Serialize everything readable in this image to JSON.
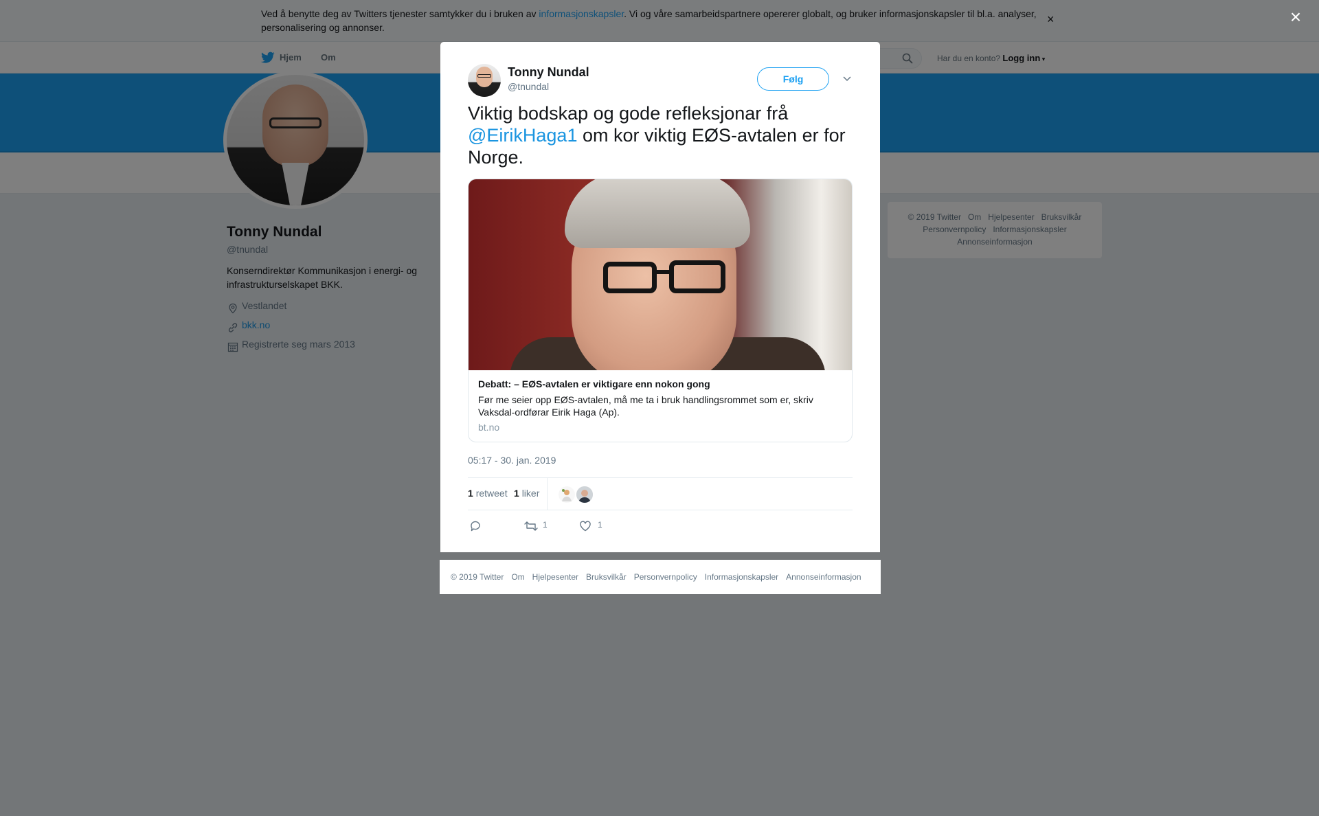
{
  "cookie_banner": {
    "text_before": "Ved å benytte deg av Twitters tjenester samtykker du i bruken av ",
    "link": "informasjonskapsler",
    "text_after": ". Vi og våre samarbeidspartnere opererer globalt, og bruker informasjonskapsler til bl.a. analyser, personalisering og annonser.",
    "close": "×"
  },
  "nav": {
    "home": "Hjem",
    "about": "Om",
    "account_prompt": "Har du en konto?",
    "login": "Logg inn"
  },
  "profile": {
    "name": "Tonny Nundal",
    "handle": "@tnundal",
    "bio": "Konserndirektør Kommunikasjon i energi- og infrastrukturselskapet BKK.",
    "location": "Vestlandet",
    "website": "bkk.no",
    "joined": "Registrerte seg mars 2013"
  },
  "side_footer": {
    "links": [
      "© 2019 Twitter",
      "Om",
      "Hjelpesenter",
      "Bruksvilkår",
      "Personvernpolicy",
      "Informasjonskapsler",
      "Annonseinformasjon"
    ]
  },
  "overlay_close": "×",
  "tweet": {
    "author_name": "Tonny Nundal",
    "author_handle": "@tnundal",
    "follow_label": "Følg",
    "text_part1": "Viktig bodskap og gode refleksjonar frå ",
    "mention": "@EirikHaga1",
    "text_part2": " om kor viktig EØS-avtalen er for Norge.",
    "card": {
      "title": "Debatt: – EØS-avtalen er viktigare enn nokon gong",
      "description": "Før me seier opp EØS-avtalen, må me ta i bruk handlingsrommet som er, skriv Vaksdal-ordførar Eirik Haga (Ap).",
      "domain": "bt.no"
    },
    "timestamp": "05:17 - 30. jan. 2019",
    "retweets_count": "1",
    "retweets_label": "retweet",
    "likes_count": "1",
    "likes_label": "liker",
    "action_retweet_count": "1",
    "action_like_count": "1"
  },
  "modal_footer": {
    "links": [
      "© 2019 Twitter",
      "Om",
      "Hjelpesenter",
      "Bruksvilkår",
      "Personvernpolicy",
      "Informasjonskapsler",
      "Annonseinformasjon"
    ]
  },
  "colors": {
    "accent": "#1da1f2",
    "banner": "#1da1f2",
    "link": "#1b95e0"
  }
}
